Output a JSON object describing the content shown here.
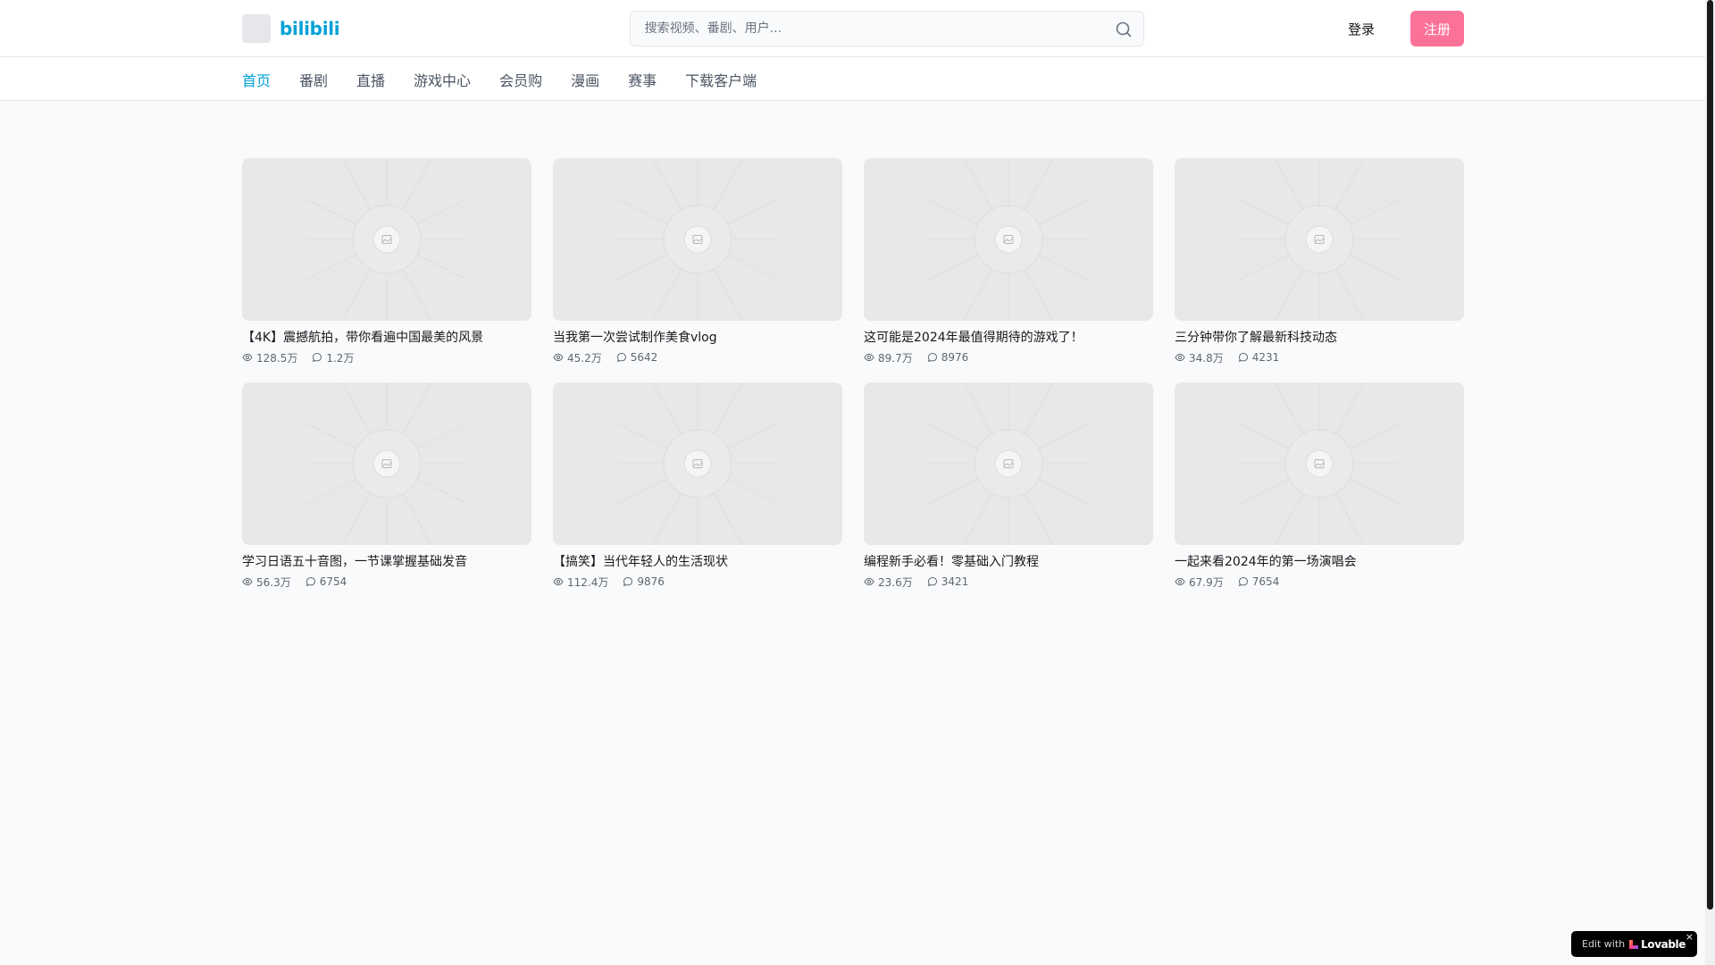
{
  "header": {
    "logo_text": "bilibili",
    "search_placeholder": "搜索视频、番剧、用户...",
    "login_label": "登录",
    "register_label": "注册"
  },
  "nav": {
    "items": [
      {
        "label": "首页"
      },
      {
        "label": "番剧"
      },
      {
        "label": "直播"
      },
      {
        "label": "游戏中心"
      },
      {
        "label": "会员购"
      },
      {
        "label": "漫画"
      },
      {
        "label": "赛事"
      },
      {
        "label": "下载客户端"
      }
    ],
    "active_index": 0
  },
  "videos": [
    {
      "title": "【4K】震撼航拍，带你看遍中国最美的风景",
      "views": "128.5万",
      "comments": "1.2万"
    },
    {
      "title": "当我第一次尝试制作美食vlog",
      "views": "45.2万",
      "comments": "5642"
    },
    {
      "title": "这可能是2024年最值得期待的游戏了！",
      "views": "89.7万",
      "comments": "8976"
    },
    {
      "title": "三分钟带你了解最新科技动态",
      "views": "34.8万",
      "comments": "4231"
    },
    {
      "title": "学习日语五十音图，一节课掌握基础发音",
      "views": "56.3万",
      "comments": "6754"
    },
    {
      "title": "【搞笑】当代年轻人的生活现状",
      "views": "112.4万",
      "comments": "9876"
    },
    {
      "title": "编程新手必看！零基础入门教程",
      "views": "23.6万",
      "comments": "3421"
    },
    {
      "title": "一起来看2024年的第一场演唱会",
      "views": "67.9万",
      "comments": "7654"
    }
  ],
  "badge": {
    "prefix": "Edit with",
    "brand": "Lovable",
    "close": "×"
  },
  "icons": {
    "search": "search-icon",
    "views": "eye-icon",
    "comments": "comment-icon",
    "thumbnail": "image-placeholder-icon"
  },
  "colors": {
    "brand_blue": "#00a1d6",
    "brand_pink": "#fb7299",
    "page_bg": "#f9fafb",
    "text": "#18191c",
    "muted": "#61666d"
  }
}
